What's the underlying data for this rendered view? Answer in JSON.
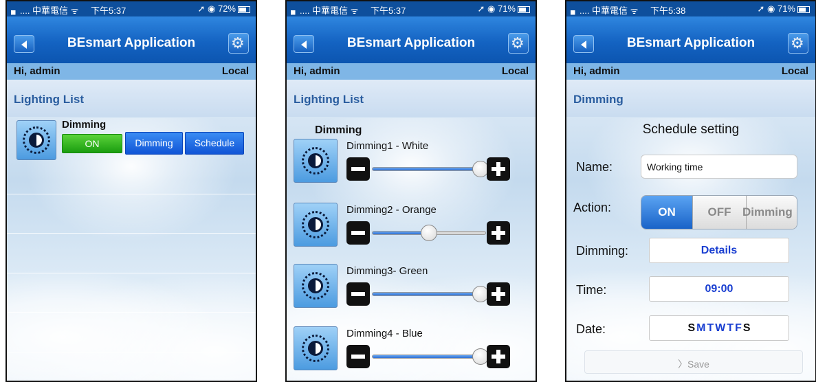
{
  "status_bar": {
    "carrier": "▖.... 中華電信 ᯤ",
    "screens": [
      {
        "time": "下午5:37",
        "battery": "72%"
      },
      {
        "time": "下午5:37",
        "battery": "71%"
      },
      {
        "time": "下午5:38",
        "battery": "71%"
      }
    ]
  },
  "app": {
    "title": "BEsmart Application",
    "greeting": "Hi, admin",
    "mode": "Local"
  },
  "screen1": {
    "section_title": "Lighting List",
    "device_name": "Dimming",
    "on_label": "ON",
    "dimming_label": "Dimming",
    "schedule_label": "Schedule"
  },
  "screen2": {
    "section_title": "Lighting List",
    "group_name": "Dimming",
    "channels": [
      {
        "name": "Dimming1 - White",
        "level": 0.95
      },
      {
        "name": "Dimming2 - Orange",
        "level": 0.5
      },
      {
        "name": "Dimming3- Green",
        "level": 0.95
      },
      {
        "name": "Dimming4 - Blue",
        "level": 0.95
      }
    ]
  },
  "screen3": {
    "section_title": "Dimming",
    "heading": "Schedule setting",
    "name_label": "Name:",
    "name_value": "Working time",
    "action_label": "Action:",
    "action_options": [
      "ON",
      "OFF",
      "Dimming"
    ],
    "action_selected": "ON",
    "dimming_label": "Dimming:",
    "dimming_value": "Details",
    "time_label": "Time:",
    "time_value": "09:00",
    "date_label": "Date:",
    "date_days": [
      "S",
      "M",
      "T",
      "W",
      "T",
      "F",
      "S"
    ],
    "save_label": "Save",
    "colors": {
      "day_active": "#1a3fd1",
      "day_inactive": "#111111",
      "link_blue": "#1a3fd1"
    }
  }
}
